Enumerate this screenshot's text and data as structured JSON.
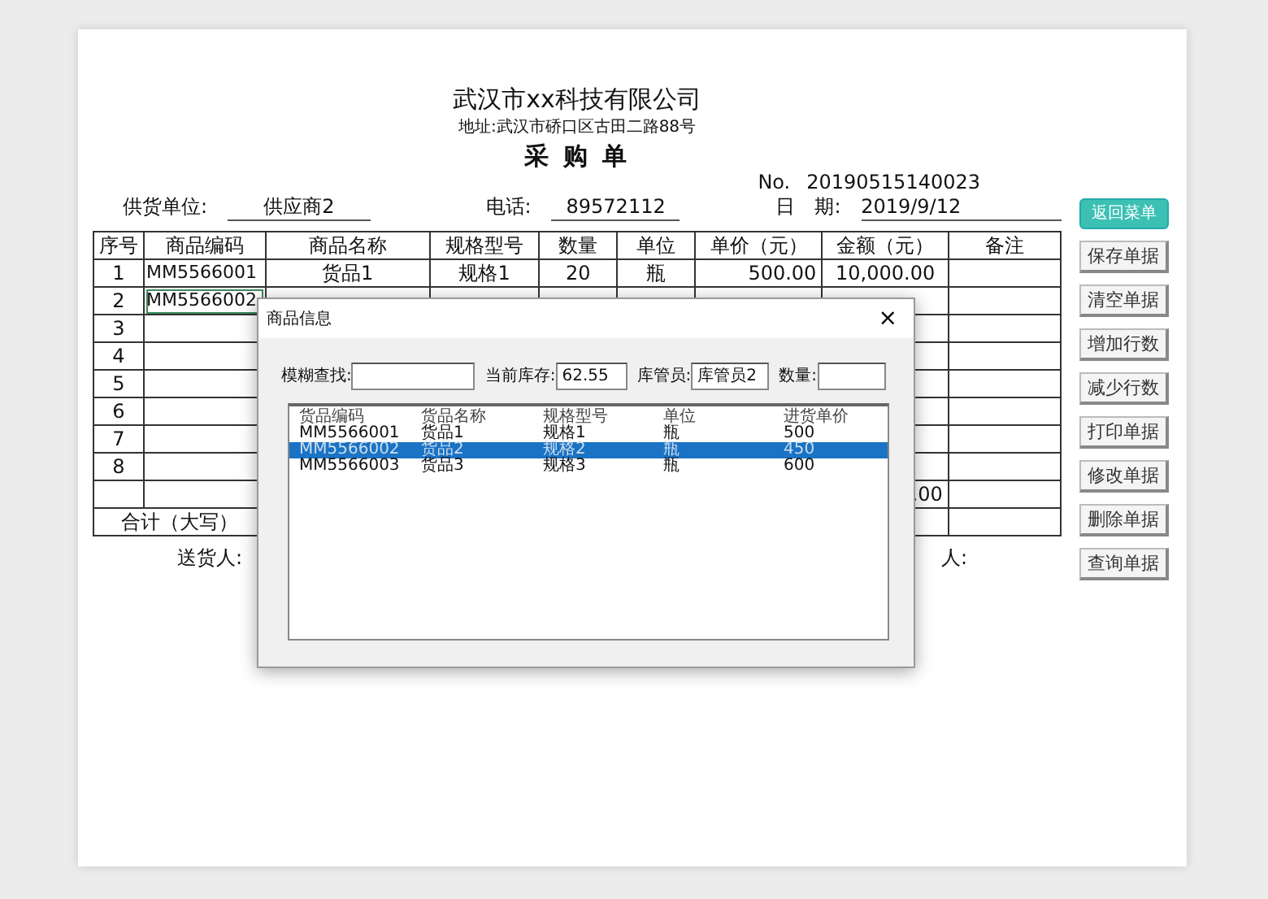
{
  "company": "武汉市xx科技有限公司",
  "address": "地址:武汉市硚口区古田二路88号",
  "doc_title": "采 购 单",
  "number": {
    "label": "No.",
    "value": "20190515140023"
  },
  "header_fields": [
    {
      "label": "供货单位:",
      "value": "供应商2"
    },
    {
      "label": "电话:",
      "value": "89572112"
    },
    {
      "label": "日　期:",
      "value": "2019/9/12"
    }
  ],
  "table": {
    "columns": [
      "序号",
      "商品编码",
      "商品名称",
      "规格型号",
      "数量",
      "单位",
      "单价（元）",
      "金额（元）",
      "备注"
    ],
    "rows": [
      {
        "no": "1",
        "code": "MM5566001",
        "name": "货品1",
        "spec": "规格1",
        "qty": "20",
        "unit": "瓶",
        "price": "500.00",
        "amount": "10,000.00",
        "selected": false
      },
      {
        "no": "2",
        "code": "MM5566002",
        "selected": true
      },
      {
        "no": "3",
        "selected": false
      },
      {
        "no": "4",
        "selected": false
      },
      {
        "no": "5",
        "selected": false
      },
      {
        "no": "6",
        "selected": false
      },
      {
        "no": "7",
        "selected": false
      },
      {
        "no": "8",
        "selected": false
      }
    ],
    "subtotal_amount": ".00",
    "total_label": "合计（大写）"
  },
  "signatures": [
    "送货人:",
    "人:"
  ],
  "buttons": [
    {
      "label": "返回菜单",
      "kind": "primary"
    },
    {
      "label": "保存单据",
      "kind": "default"
    },
    {
      "label": "清空单据",
      "kind": "default"
    },
    {
      "label": "增加行数",
      "kind": "default"
    },
    {
      "label": "减少行数",
      "kind": "default"
    },
    {
      "label": "打印单据",
      "kind": "default"
    },
    {
      "label": "修改单据",
      "kind": "default"
    },
    {
      "label": "删除单据",
      "kind": "default"
    },
    {
      "label": "查询单据",
      "kind": "default"
    }
  ],
  "dialog": {
    "title": "商品信息",
    "close": "×",
    "fields": [
      {
        "label": "模糊查找:"
      },
      {
        "label": "当前库存:",
        "value": "62.55"
      },
      {
        "label": "库管员:",
        "value": "库管员2"
      },
      {
        "label": "数量:"
      }
    ],
    "list": {
      "columns": [
        "货品编码",
        "货品名称",
        "规格型号",
        "单位",
        "进货单价"
      ],
      "rows": [
        {
          "cells": [
            "MM5566001",
            "货品1",
            "规格1",
            "瓶",
            "500"
          ],
          "selected": false
        },
        {
          "cells": [
            "MM5566002",
            "货品2",
            "规格2",
            "瓶",
            "450"
          ],
          "selected": true
        },
        {
          "cells": [
            "MM5566003",
            "货品3",
            "规格3",
            "瓶",
            "600"
          ],
          "selected": false
        }
      ]
    }
  }
}
